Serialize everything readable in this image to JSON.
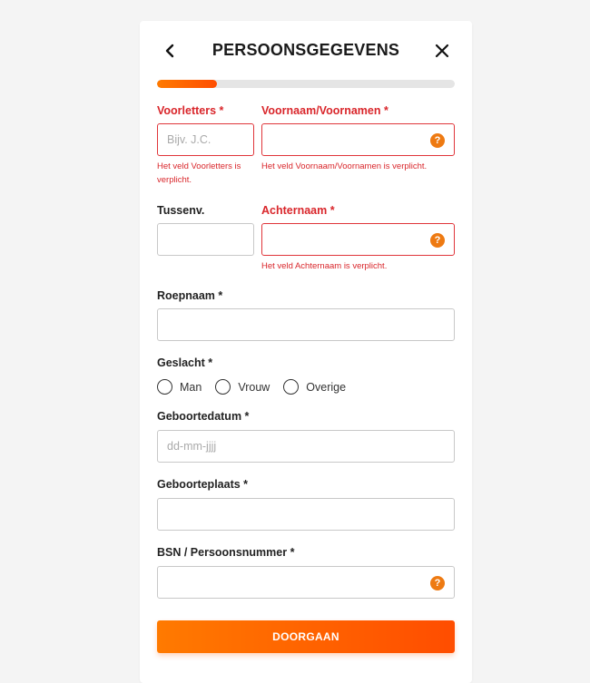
{
  "header": {
    "title": "PERSOONSGEGEVENS"
  },
  "progress": {
    "fraction": 0.2
  },
  "fields": {
    "voorletters": {
      "label": "Voorletters *",
      "placeholder": "Bijv. J.C.",
      "value": "",
      "error": "Het veld Voorletters is verplicht."
    },
    "voornaam": {
      "label": "Voornaam/Voornamen *",
      "placeholder": "",
      "value": "",
      "error": "Het veld Voornaam/Voornamen is verplicht."
    },
    "tussenvoegsel": {
      "label": "Tussenv.",
      "placeholder": "",
      "value": ""
    },
    "achternaam": {
      "label": "Achternaam *",
      "placeholder": "",
      "value": "",
      "error": "Het veld Achternaam is verplicht."
    },
    "roepnaam": {
      "label": "Roepnaam *",
      "placeholder": "",
      "value": ""
    },
    "geslacht": {
      "label": "Geslacht *",
      "options": [
        "Man",
        "Vrouw",
        "Overige"
      ]
    },
    "geboortedatum": {
      "label": "Geboortedatum *",
      "placeholder": "dd-mm-jjjj",
      "value": ""
    },
    "geboorteplaats": {
      "label": "Geboorteplaats *",
      "placeholder": "",
      "value": ""
    },
    "bsn": {
      "label": "BSN / Persoonsnummer *",
      "placeholder": "",
      "value": ""
    }
  },
  "help_icon_glyph": "?",
  "submit_label": "DOORGAAN",
  "colors": {
    "accent": "#ff6a00",
    "error": "#d9262b",
    "help": "#ee7a12"
  }
}
